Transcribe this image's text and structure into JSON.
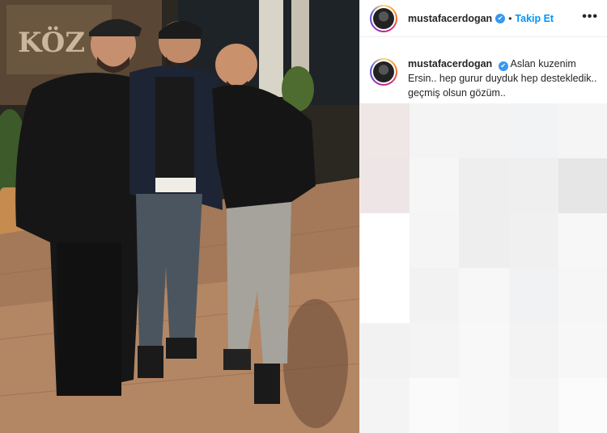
{
  "post": {
    "username": "mustafacerdogan",
    "follow_label": "Takip Et",
    "more_label": "•••",
    "separator": "•",
    "verified_glyph": "✔",
    "photo_sign_text": "KÖZ"
  },
  "caption": {
    "username": "mustafacerdogan",
    "verified_glyph": "✔",
    "text": "Aslan kuzenim Ersin.. hep gurur duyduk hep destekledik.. geçmiş olsun gözüm.."
  },
  "colors": {
    "accent": "#0095f6",
    "verified": "#3897f0",
    "text": "#262626"
  },
  "blurred_tiles": [
    "#efe6e6",
    "#f4f4f4",
    "#f3f3f3",
    "#f2f3f5",
    "#f5f5f5",
    "#eee6e6",
    "#f6f6f6",
    "#eeeeee",
    "#efefef",
    "#e6e6e6",
    "#ffffff",
    "#f5f5f5",
    "#eeeeee",
    "#f0f0f0",
    "#f7f7f7",
    "#ffffff",
    "#f2f2f2",
    "#f7f7f7",
    "#f1f2f4",
    "#f6f6f6",
    "#f2f2f2",
    "#f4f4f4",
    "#f8f8f8",
    "#f3f3f3",
    "#f7f7f7",
    "#f4f4f4",
    "#fafafa",
    "#f8f8f8",
    "#f5f5f5",
    "#fbfbfb"
  ]
}
